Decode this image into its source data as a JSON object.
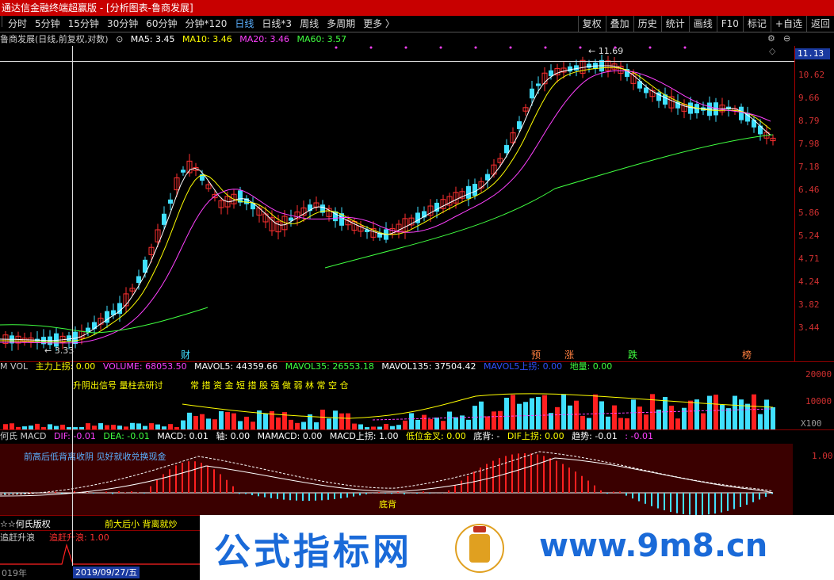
{
  "window_title": "通达信金融终端超赢版 - [分析图表-鲁商发展]",
  "toolbar": {
    "periods": [
      "分时",
      "5分钟",
      "15分钟",
      "30分钟",
      "60分钟",
      "分钟*120",
      "日线",
      "日线*3",
      "周线",
      "多周期",
      "更多 〉"
    ],
    "active_period": "日线",
    "right_buttons": [
      "复权",
      "叠加",
      "历史",
      "统计",
      "画线",
      "F10",
      "标记",
      "+自选",
      "返回"
    ]
  },
  "info": {
    "stock": "鲁商发展(日线,前复权,对数)",
    "ma5": "MA5: 3.45",
    "ma10": "MA10: 3.46",
    "ma20": "MA20: 3.46",
    "ma60": "MA60: 3.57"
  },
  "price_axis": {
    "current": "11.13",
    "labels": [
      "10.62",
      "9.66",
      "8.79",
      "7.98",
      "7.18",
      "6.46",
      "5.86",
      "5.24",
      "4.71",
      "4.24",
      "3.82",
      "3.44"
    ]
  },
  "annotations": {
    "high": "11.69",
    "low": "3.33",
    "tags": [
      "财",
      "预",
      "涨",
      "跌",
      "榜"
    ]
  },
  "volume": {
    "title": "M VOL",
    "zhuli": "主力上拐: 0.00",
    "volume": "VOLUME: 68053.50",
    "mavol5": "MAVOL5: 44359.66",
    "mavol35": "MAVOL35: 26553.18",
    "mavol135": "MAVOL135: 37504.42",
    "mavol5up": "MAVOL5上拐: 0.00",
    "diliang": "地量: 0.00",
    "signal1": "升阴出信号  量柱去研讨",
    "signal2": "常 措 资 金 短 措 股  强 做 弱 林 常 空 仓",
    "axis": [
      "20000",
      "10000"
    ],
    "unit": "X100"
  },
  "macd": {
    "title": "何氏 MACD",
    "dif": "DIF: -0.01",
    "dea": "DEA: -0.01",
    "macd": "MACD: 0.01",
    "zhou": "轴: 0.00",
    "mamacd": "MAMACD: 0.00",
    "macdup": "MACD上拐: 1.00",
    "diwei": "低位金叉: 0.00",
    "dibei": "底背: -",
    "difup": "DIF上拐: 0.00",
    "qushi": "趋势: -0.01",
    "last": ": -0.01",
    "text1": "前高后低背离收阴   见好就收兑换现金",
    "dibei_label": "底背",
    "axis": "1.00"
  },
  "bottom": {
    "title1": "☆☆何氏版权",
    "text1": "前大后小   背离就炒",
    "title2": "追赶升浪",
    "value2": "追赶升浪: 1.00",
    "year": "019年",
    "date": "2019/09/27/五"
  },
  "watermark": {
    "left": "公式指标网",
    "right": "www.9m8.cn"
  }
}
